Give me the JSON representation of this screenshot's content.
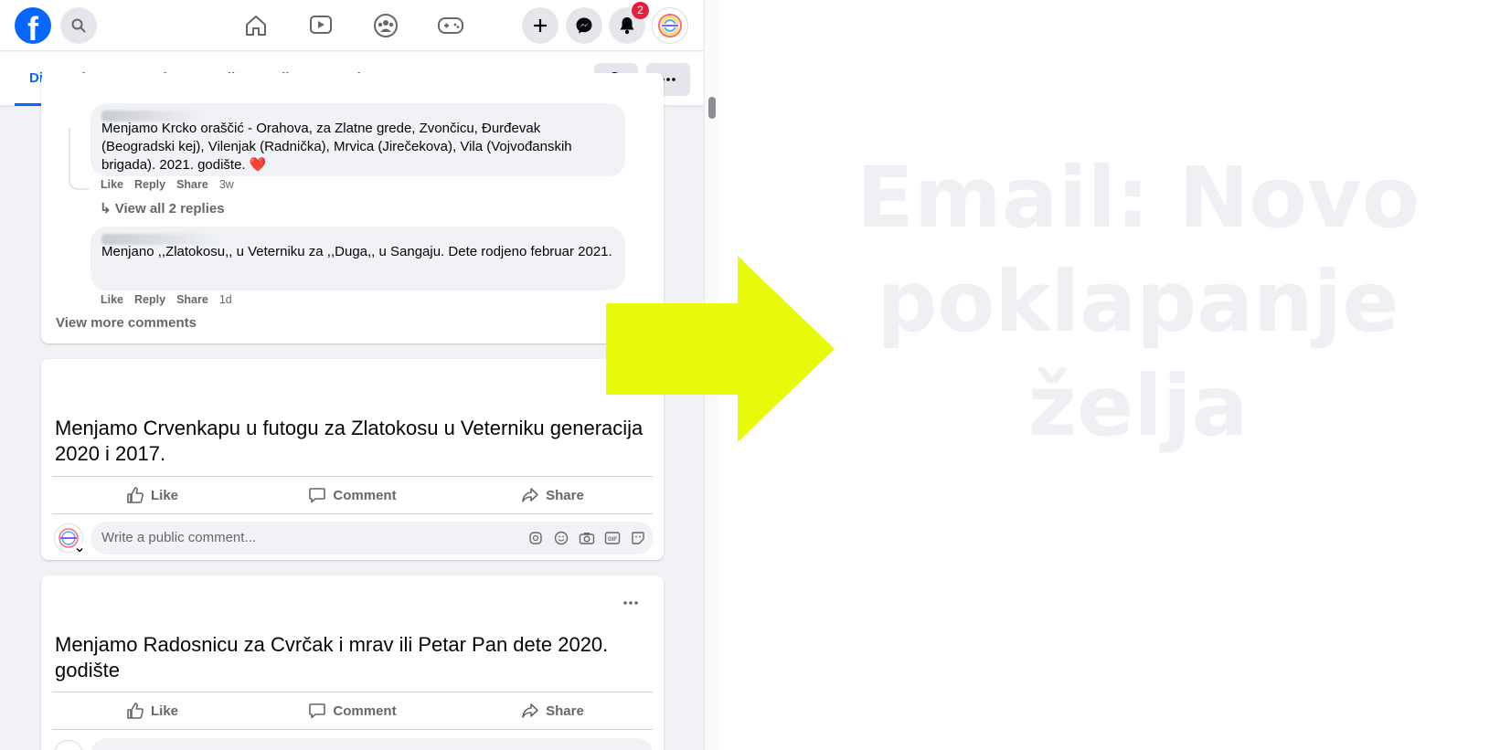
{
  "topbar": {
    "logo_letter": "f",
    "notifications_count": "2",
    "icons": [
      "facebook-logo-icon",
      "search-icon",
      "home-icon",
      "video-icon",
      "groups-icon",
      "gaming-icon",
      "create-plus-icon",
      "messenger-icon",
      "bell-icon",
      "profile-avatar"
    ]
  },
  "tabs": [
    {
      "label": "Discussion",
      "active": true
    },
    {
      "label": "People",
      "active": false
    },
    {
      "label": "Media",
      "active": false
    },
    {
      "label": "Files",
      "active": false
    },
    {
      "label": "Reels",
      "active": false
    }
  ],
  "comments": {
    "first": {
      "text": "Menjamo Krcko oraščić - Orahova, za Zlatne grede, Zvončicu, Đurđevak (Beogradski kej), Vilenjak (Radnička), Mrvica (Jirečekova), Vila (Vojvođanskih brigada). 2021. godište. ❤️",
      "like": "Like",
      "reply": "Reply",
      "share": "Share",
      "time": "3w",
      "view_replies": "View all 2 replies"
    },
    "second": {
      "text": "Menjano ,,Zlatokosu,, u Veterniku za ,,Duga,, u Sangaju. Dete rodjeno februar 2021.",
      "like": "Like",
      "reply": "Reply",
      "share": "Share",
      "time": "1d"
    },
    "view_more": "View more comments"
  },
  "posts": [
    {
      "text": "Menjamo Crvenkapu u futogu za Zlatokosu u Veterniku generacija 2020 i 2017.",
      "like": "Like",
      "comment": "Comment",
      "share": "Share",
      "placeholder": "Write a public comment..."
    },
    {
      "text": "Menjamo Radosnicu za Cvrčak i mrav ili Petar Pan dete 2020. godište",
      "like": "Like",
      "comment": "Comment",
      "share": "Share"
    }
  ],
  "overlay": {
    "text": "Email: Novo poklapanje želja",
    "arrow_color": "#e8f90a",
    "text_color": "#eff0f4"
  },
  "colors": {
    "brand": "#0866ff",
    "badge": "#e41e3f"
  }
}
